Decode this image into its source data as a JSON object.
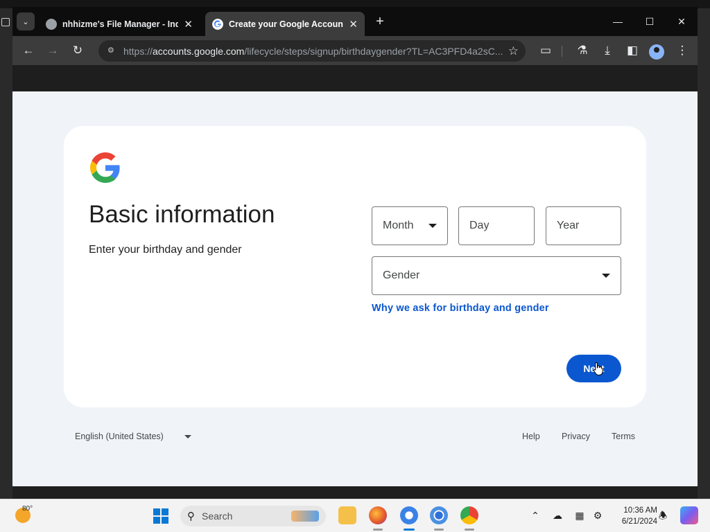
{
  "browser": {
    "tabs": [
      {
        "title": "nhhizme's File Manager - Index",
        "active": false
      },
      {
        "title": "Create your Google Account",
        "active": true
      }
    ],
    "url_host": "accounts.google.com",
    "url_prefix": "https://",
    "url_path": "/lifecycle/steps/signup/birthdaygender?TL=AC3PFD4a2sC..."
  },
  "page": {
    "heading": "Basic information",
    "subheading": "Enter your birthday and gender",
    "fields": {
      "month_placeholder": "Month",
      "day_placeholder": "Day",
      "year_placeholder": "Year",
      "gender_placeholder": "Gender"
    },
    "why_link": "Why we ask for birthday and gender",
    "next_label": "Next",
    "google_colors": {
      "blue": "#4285F4",
      "red": "#EA4335",
      "yellow": "#FBBC05",
      "green": "#34A853"
    },
    "accent": "#0b57d0"
  },
  "footer": {
    "language": "English (United States)",
    "links": [
      "Help",
      "Privacy",
      "Terms"
    ]
  },
  "taskbar": {
    "temperature": "80°",
    "search_label": "Search",
    "time": "10:36 AM",
    "date": "6/21/2024",
    "apps": [
      "file-explorer",
      "firefox",
      "chrome-canary",
      "chromium",
      "chrome"
    ]
  }
}
